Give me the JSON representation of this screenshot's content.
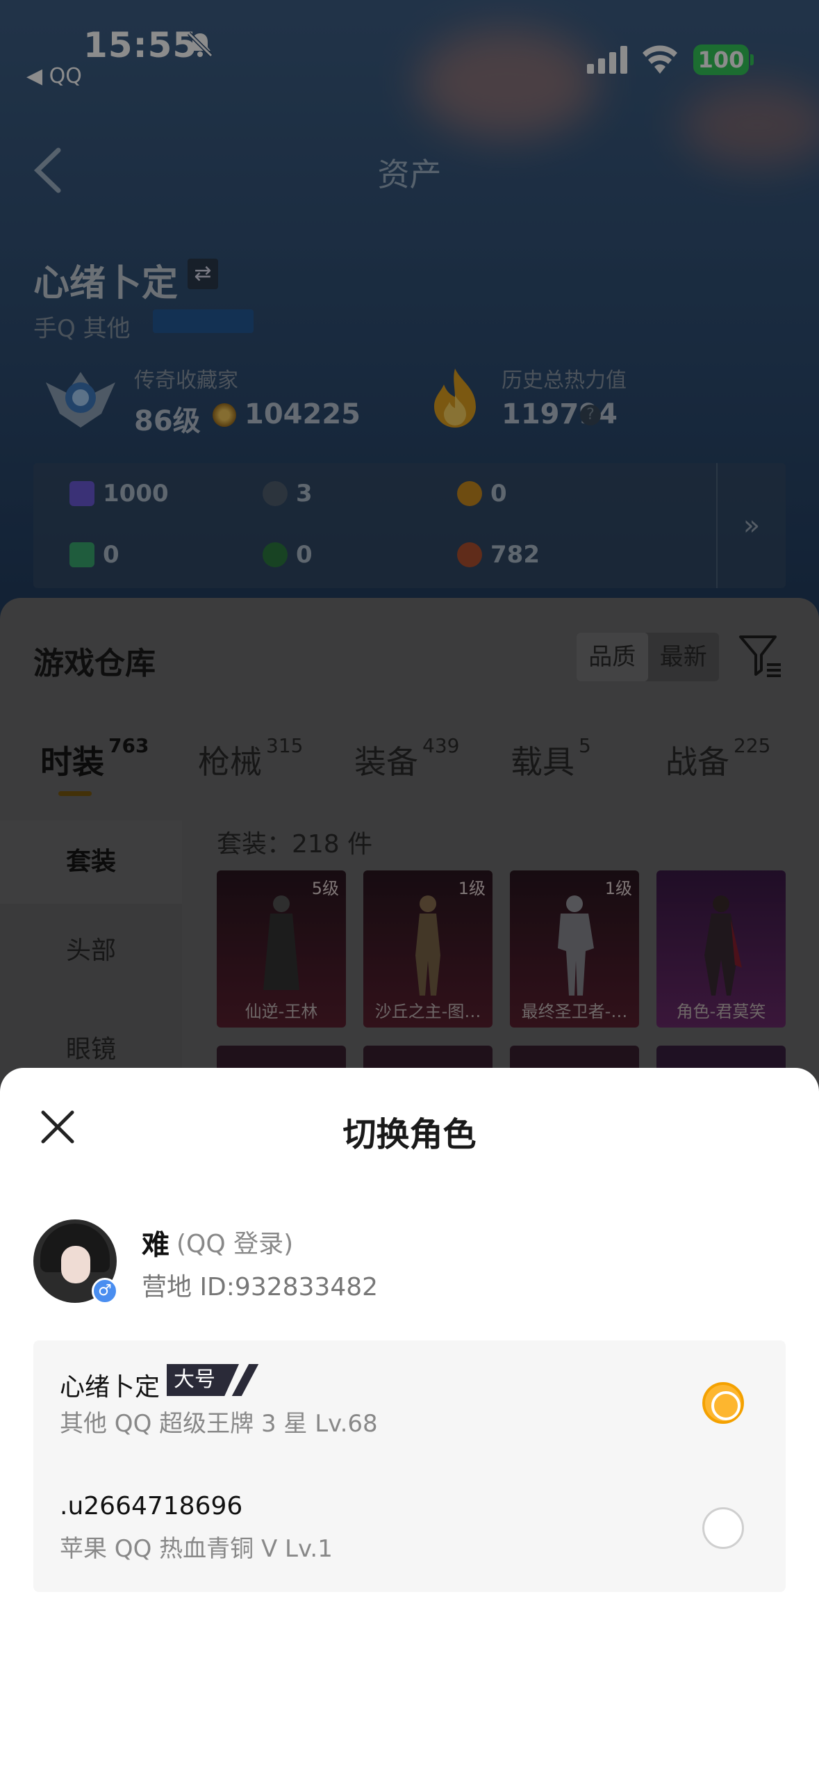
{
  "status_bar": {
    "time": "15:55",
    "back_app": "◀ QQ",
    "battery": "100"
  },
  "nav": {
    "title": "资产"
  },
  "profile": {
    "name": "心绪卜定",
    "platform": "手Q 其他",
    "rank_label": "传奇收藏家",
    "level": "86级",
    "coins": "104225",
    "heat_label": "历史总热力值",
    "heat_value": "119794"
  },
  "resources": [
    {
      "value": "1000",
      "icon": "card-icon",
      "color": "#6a5ad8"
    },
    {
      "value": "3",
      "icon": "token-icon",
      "color": "#506070"
    },
    {
      "value": "0",
      "icon": "gold-token-icon",
      "color": "#c88a20"
    },
    {
      "value": "0",
      "icon": "green-card-icon",
      "color": "#3aa870"
    },
    {
      "value": "0",
      "icon": "green-orb-icon",
      "color": "#2d7a40"
    },
    {
      "value": "782",
      "icon": "red-orb-icon",
      "color": "#b05030"
    }
  ],
  "warehouse": {
    "title": "游戏仓库",
    "sort_options": [
      "品质",
      "最新"
    ],
    "tabs": [
      {
        "label": "时装",
        "count": "763"
      },
      {
        "label": "枪械",
        "count": "315"
      },
      {
        "label": "装备",
        "count": "439"
      },
      {
        "label": "载具",
        "count": "5"
      },
      {
        "label": "战备",
        "count": "225"
      }
    ],
    "side_items": [
      "套装",
      "头部",
      "眼镜"
    ],
    "caption": "套装：218 件",
    "cards": [
      {
        "level": "5级",
        "name": "仙逆-王林",
        "rarity": "red"
      },
      {
        "level": "1级",
        "name": "沙丘之主-图…",
        "rarity": "red"
      },
      {
        "level": "1级",
        "name": "最终圣卫者-…",
        "rarity": "red"
      },
      {
        "level": "",
        "name": "角色-君莫笑",
        "rarity": "purple"
      }
    ]
  },
  "sheet": {
    "title": "切换角色",
    "user": {
      "name": "难",
      "login": "(QQ 登录)",
      "id": "营地 ID:932833482"
    },
    "roles": [
      {
        "name": "心绪卜定",
        "tag": "大号",
        "detail": "其他 QQ   超级王牌 3 星   Lv.68",
        "selected": true
      },
      {
        "name": ".u2664718696",
        "tag": "",
        "detail": "苹果 QQ   热血青铜 V   Lv.1",
        "selected": false
      }
    ]
  },
  "colors": {
    "accent": "#fdb62f",
    "sheet_bg": "#ffffff",
    "list_bg": "#f6f6f6"
  }
}
